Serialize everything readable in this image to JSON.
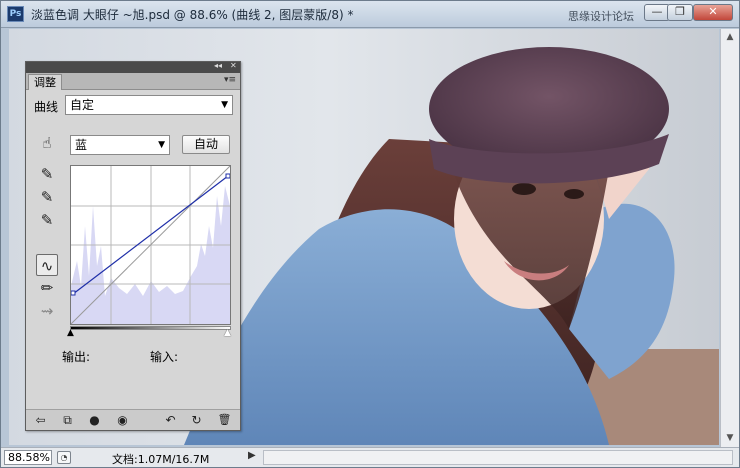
{
  "window": {
    "app_logo": "Ps",
    "title": "淡蓝色调 大眼仔 ~旭.psd @ 88.6% (曲线 2, 图层蒙版/8) *",
    "watermark": "思缘设计论坛",
    "minimize_glyph": "—",
    "restore_glyph": "❐",
    "close_glyph": "✕"
  },
  "panel": {
    "collapse_glyph": "◂◂",
    "close_glyph": "✕",
    "tab_label": "调整",
    "menu_glyph": "▾≡",
    "curve_label": "曲线",
    "preset_value": "自定",
    "channel_value": "蓝",
    "auto_button": "自动",
    "output_label": "输出:",
    "input_label": "输入:",
    "tools": {
      "hand": "☝",
      "eyedropper_black": "✎",
      "eyedropper_gray": "✎",
      "eyedropper_white": "✎",
      "curve": "∿",
      "pencil": "✏",
      "smooth": "⇝"
    },
    "bottom_icons": {
      "back": "⇦",
      "layer": "⧉",
      "clip": "●",
      "eye": "◉",
      "prev_state": "↶",
      "reset": "↻",
      "trash": "🗑"
    }
  },
  "status": {
    "zoom": "88.58%",
    "doc_info": "文档:1.07M/16.7M",
    "arrow": "▶"
  },
  "colors": {
    "curve_line": "#1f2fa8",
    "histogram_fill": "#d8d8f4",
    "panel_bg": "#d6d6d6"
  }
}
